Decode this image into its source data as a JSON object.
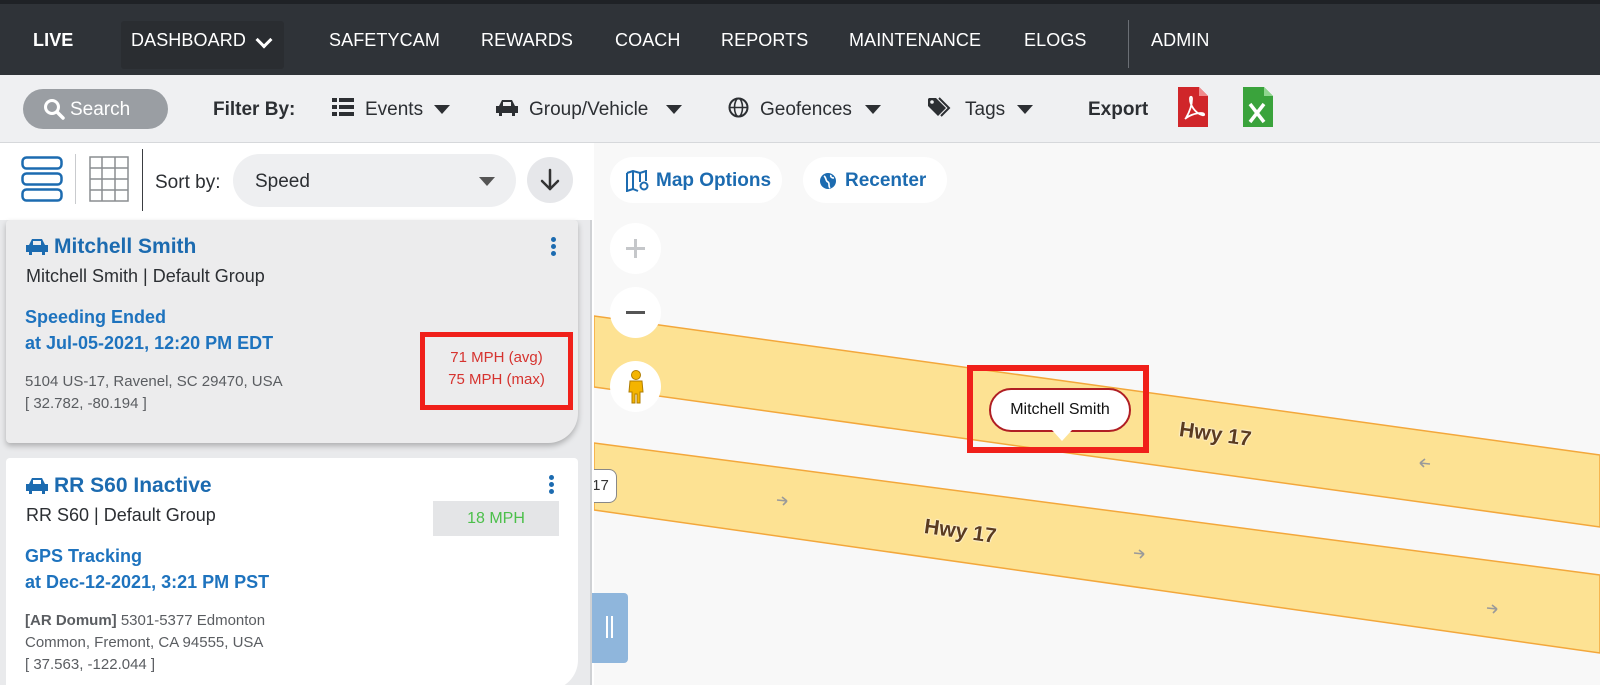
{
  "nav": {
    "live": "LIVE",
    "dashboard": "DASHBOARD",
    "safetycam": "SAFETYCAM",
    "rewards": "REWARDS",
    "coach": "COACH",
    "reports": "REPORTS",
    "maintenance": "MAINTENANCE",
    "elogs": "ELOGS",
    "admin": "ADMIN"
  },
  "filterbar": {
    "search": "Search",
    "filter_by": "Filter By:",
    "events": "Events",
    "group_vehicle": "Group/Vehicle",
    "geofences": "Geofences",
    "tags": "Tags",
    "export": "Export"
  },
  "sort": {
    "label": "Sort by:",
    "value": "Speed"
  },
  "cards": [
    {
      "title": "Mitchell Smith",
      "subtitle": "Mitchell Smith |  Default Group",
      "speed_avg": "71 MPH (avg)",
      "speed_max": "75 MPH (max)",
      "event": "Speeding Ended",
      "event_time": "at Jul-05-2021, 12:20 PM EDT",
      "address": "5104 US-17, Ravenel, SC 29470, USA",
      "coords": "[ 32.782, -80.194 ]"
    },
    {
      "title": "RR S60 Inactive",
      "subtitle": "RR S60 |  Default Group",
      "speed": "18 MPH",
      "event": "GPS Tracking",
      "event_time": "at Dec-12-2021, 3:21 PM PST",
      "address_prefix": "[AR Domum]",
      "address_line1": " 5301-5377 Edmonton",
      "address_line2": "Common, Fremont, CA 94555, USA",
      "coords": "[ 37.563, -122.044 ]"
    }
  ],
  "map": {
    "map_options": "Map Options",
    "recenter": "Recenter",
    "vehicle_label": "Mitchell Smith",
    "road_label_1": "Hwy 17",
    "road_label_2": "Hwy 17",
    "shield": "17"
  },
  "colors": {
    "nav_bg": "#2f3338",
    "link_blue": "#1c6bb0",
    "highlight_red": "#f0201a",
    "speed_green": "#4bbf4a",
    "road_fill": "#fde293",
    "road_edge": "#f3a73b"
  }
}
